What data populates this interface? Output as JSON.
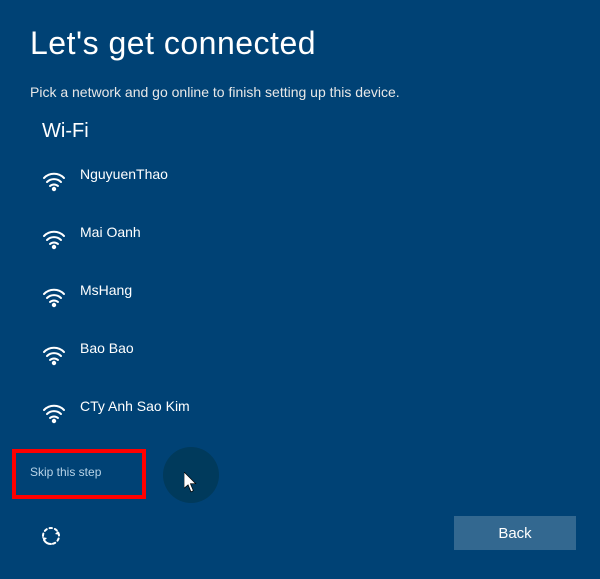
{
  "title": "Let's get connected",
  "subtitle": "Pick a network and go online to finish setting up this device.",
  "section": "Wi-Fi",
  "networks": [
    {
      "name": "NguyuenThao"
    },
    {
      "name": "Mai Oanh"
    },
    {
      "name": "MsHang"
    },
    {
      "name": "Bao Bao"
    },
    {
      "name": "CTy Anh Sao Kim"
    }
  ],
  "skip_label": "Skip this step",
  "back_label": "Back"
}
